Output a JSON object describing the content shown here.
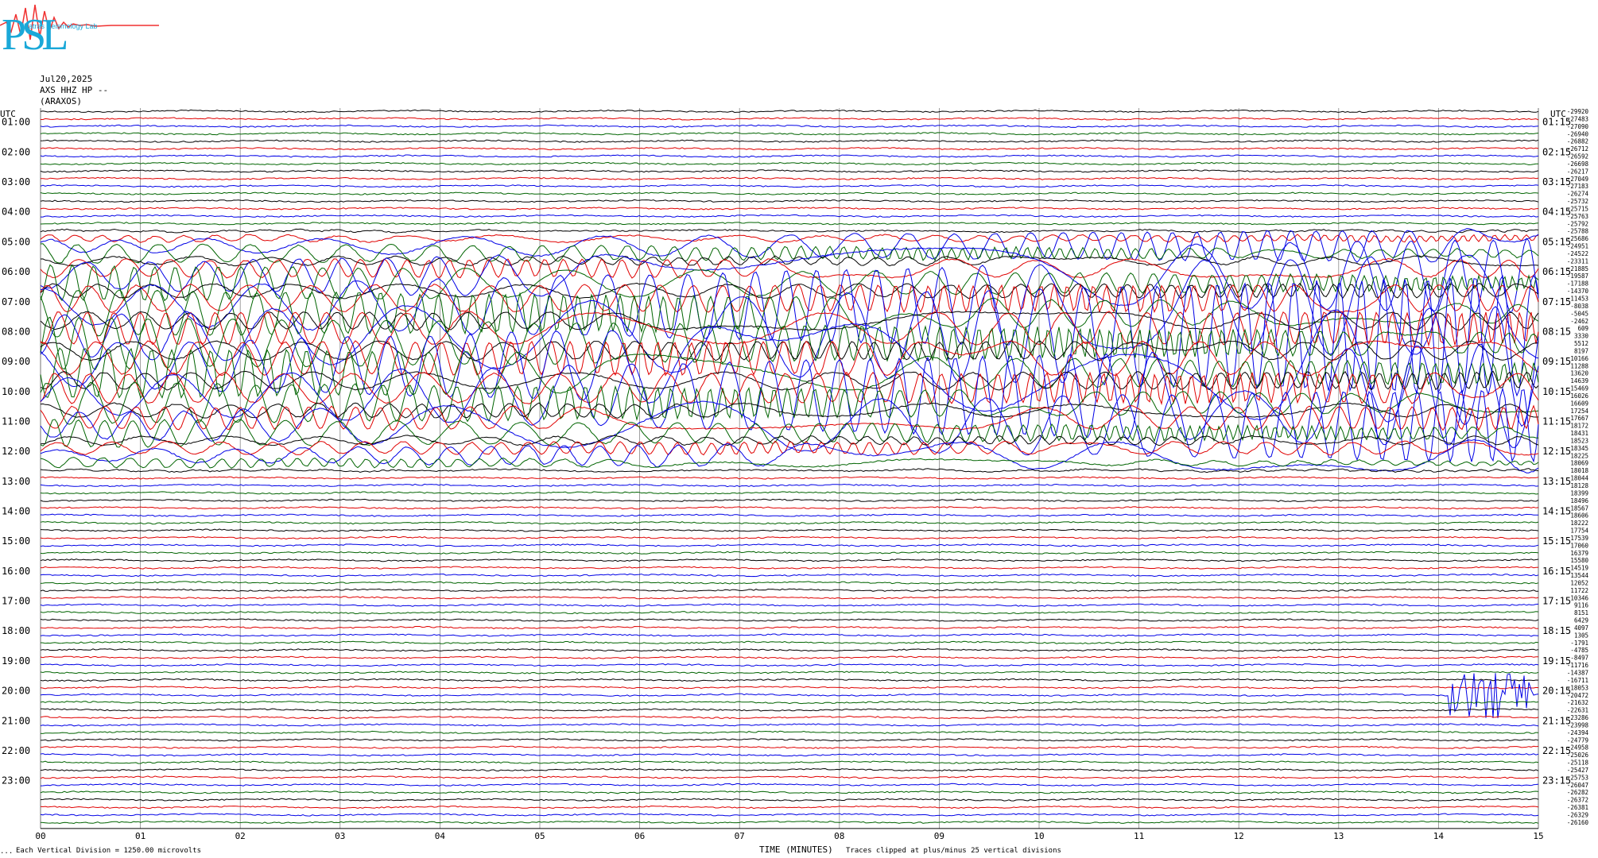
{
  "logo": {
    "big_letters": "PSL",
    "small_text": "Patras Seismology Lab"
  },
  "header": {
    "date": "Jul20,2025",
    "channel": "AXS HHZ HP --",
    "station": "(ARAXOS)"
  },
  "left_axis_title": "UTC",
  "right_axis_title": "UTC",
  "footer": {
    "division": "Each Vertical Division = 1250.00 microvolts",
    "xlabel": "TIME (MINUTES)",
    "clip_note": "Traces clipped at plus/minus 25 vertical divisions",
    "corner_mark": "..."
  },
  "colors": {
    "black": "#000000",
    "red": "#e00000",
    "blue": "#0000e6",
    "green": "#006400",
    "grid": "#888888"
  },
  "chart_data": {
    "type": "line",
    "title": "Jul20,2025 AXS HHZ HP -- (ARAXOS)",
    "xlabel": "TIME (MINUTES)",
    "ylabel": "UTC",
    "xlim": [
      0,
      15
    ],
    "x_ticks": [
      "00",
      "01",
      "02",
      "03",
      "04",
      "05",
      "06",
      "07",
      "08",
      "09",
      "10",
      "11",
      "12",
      "13",
      "14",
      "15"
    ],
    "trace_color_cycle": [
      "black",
      "red",
      "blue",
      "green"
    ],
    "left_hour_labels": [
      "01:00",
      "02:00",
      "03:00",
      "04:00",
      "05:00",
      "06:00",
      "07:00",
      "08:00",
      "09:00",
      "10:00",
      "11:00",
      "12:00",
      "13:00",
      "14:00",
      "15:00",
      "16:00",
      "17:00",
      "18:00",
      "19:00",
      "20:00",
      "21:00",
      "22:00",
      "23:00"
    ],
    "right_hour_labels": [
      "01:15",
      "02:15",
      "03:15",
      "04:15",
      "05:15",
      "06:15",
      "07:15",
      "08:15",
      "09:15",
      "10:15",
      "11:15",
      "12:15",
      "13:15",
      "14:15",
      "15:15",
      "16:15",
      "17:15",
      "18:15",
      "19:15",
      "20:15",
      "21:15",
      "22:15",
      "23:15"
    ],
    "trace_offsets": [
      "-29920",
      "-27483",
      "-27090",
      "-26940",
      "-26882",
      "-26712",
      "-26592",
      "-26698",
      "-26217",
      "-27049",
      "-27183",
      "-26274",
      "-25732",
      "-25715",
      "-25763",
      "-25792",
      "-25788",
      "-25686",
      "-24951",
      "-24522",
      "-23311",
      "-21885",
      "-19587",
      "-17188",
      "-14370",
      "-11453",
      "-8038",
      "-5045",
      "-2462",
      "609",
      "3330",
      "5512",
      "8197",
      "10166",
      "11288",
      "13620",
      "14639",
      "15469",
      "16026",
      "16609",
      "17254",
      "17667",
      "18172",
      "18431",
      "18523",
      "18345",
      "18225",
      "18069",
      "18018",
      "18044",
      "18128",
      "18399",
      "18496",
      "18567",
      "18606",
      "18222",
      "17754",
      "17539",
      "17060",
      "16379",
      "15580",
      "14519",
      "13544",
      "12052",
      "11722",
      "10346",
      "9116",
      "8151",
      "6429",
      "4097",
      "1305",
      "-1791",
      "-4785",
      "-8497",
      "-11716",
      "-14387",
      "-16711",
      "-18053",
      "-20472",
      "-21632",
      "-22631",
      "-23286",
      "-23998",
      "-24394",
      "-24779",
      "-24958",
      "-25026",
      "-25118",
      "-25427",
      "-25753",
      "-26047",
      "-26282",
      "-26372",
      "-26381",
      "-26329",
      "-26160"
    ],
    "events": [
      {
        "description": "large long-period teleseismic surface waves",
        "rows_utc": [
          "04:45",
          "12:45"
        ],
        "x_minutes": [
          0,
          15
        ],
        "clipped": true
      },
      {
        "description": "local high-frequency burst",
        "row_utc": "19:30",
        "x_minutes": [
          14.1,
          14.95
        ]
      }
    ],
    "clip_divisions": 25,
    "vertical_division_microvolts": 1250.0
  }
}
